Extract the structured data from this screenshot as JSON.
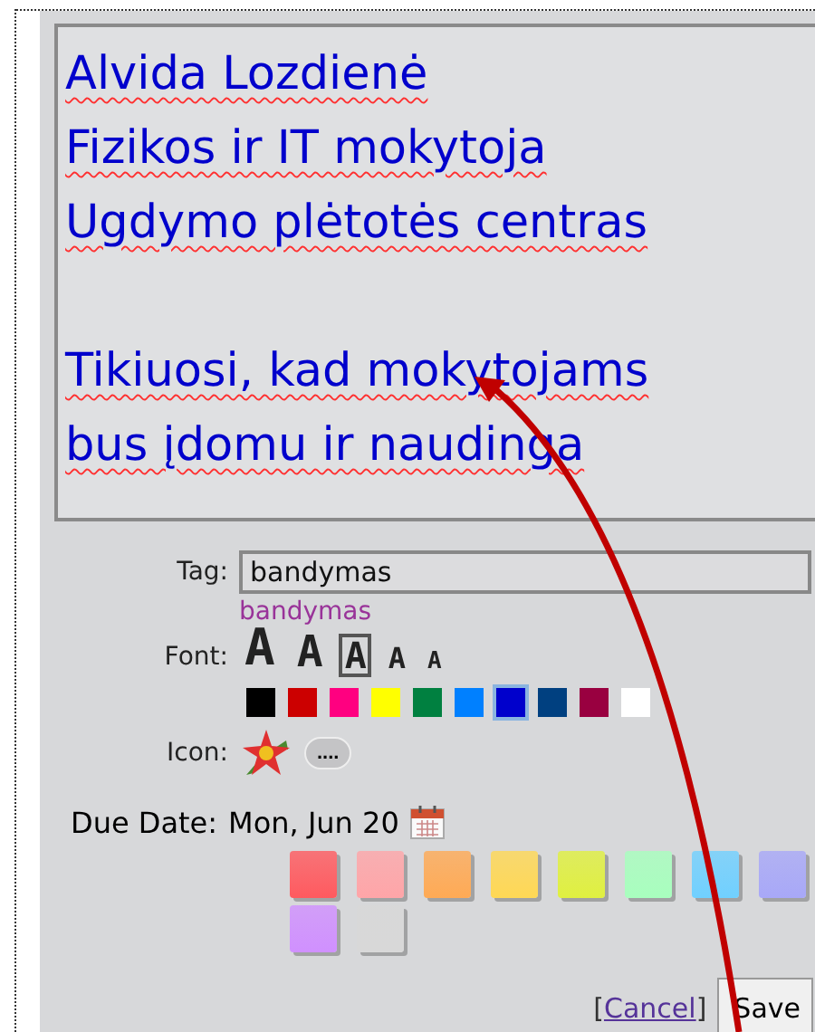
{
  "note": {
    "paragraphs": [
      [
        "Alvida Lozdienė",
        "Fizikos ir IT mokytoja",
        "Ugdymo plėtotės centras"
      ],
      [
        "Tikiuosi, kad mokytojams",
        "bus įdomu ir naudinga"
      ]
    ]
  },
  "tag": {
    "label": "Tag:",
    "value": "bandymas",
    "suggestion": "bandymas"
  },
  "font": {
    "label": "Font:",
    "sizes": [
      {
        "text": "A",
        "selected": false
      },
      {
        "text": "A",
        "selected": false
      },
      {
        "text": "A",
        "selected": true
      },
      {
        "text": "A",
        "selected": false
      },
      {
        "text": "A",
        "selected": false
      }
    ],
    "colors": [
      {
        "color": "#000000",
        "selected": false
      },
      {
        "color": "#cc0000",
        "selected": false
      },
      {
        "color": "#ff0080",
        "selected": false
      },
      {
        "color": "#ffff00",
        "selected": false
      },
      {
        "color": "#008040",
        "selected": false
      },
      {
        "color": "#0080ff",
        "selected": false
      },
      {
        "color": "#0000cc",
        "selected": true
      },
      {
        "color": "#004080",
        "selected": false
      },
      {
        "color": "#990040",
        "selected": false
      },
      {
        "color": "#ffffff",
        "selected": false
      }
    ]
  },
  "icon": {
    "label": "Icon:",
    "more_button": "...."
  },
  "due_date": {
    "label": "Due Date:",
    "value": "Mon, Jun 20"
  },
  "note_colors": [
    {
      "color": "#ff5a5f"
    },
    {
      "color": "#ffa5a8"
    },
    {
      "color": "#ffaa55"
    },
    {
      "color": "#ffd855"
    },
    {
      "color": "#e0f040"
    },
    {
      "color": "#a8ffbe"
    },
    {
      "color": "#70d0ff"
    },
    {
      "color": "#a8a8f8"
    },
    {
      "color": "#d090ff"
    },
    {
      "color": "#d8d8d8"
    }
  ],
  "footer": {
    "cancel": {
      "prefix": "[",
      "label": "Cancel",
      "suffix": "]"
    },
    "save": "Save"
  }
}
